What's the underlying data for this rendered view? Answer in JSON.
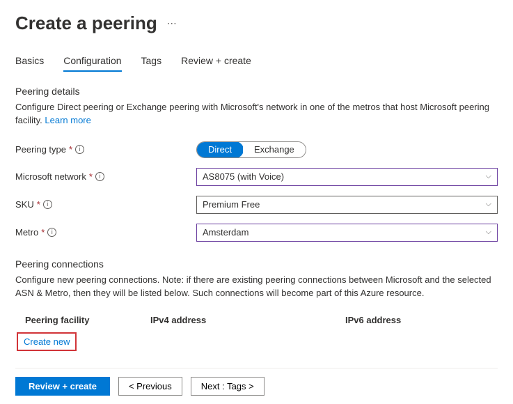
{
  "header": {
    "title": "Create a peering"
  },
  "tabs": {
    "basics": "Basics",
    "configuration": "Configuration",
    "tags": "Tags",
    "review": "Review + create"
  },
  "details": {
    "title": "Peering details",
    "desc": "Configure Direct peering or Exchange peering with Microsoft's network in one of the metros that host Microsoft peering facility. ",
    "learnMore": "Learn more"
  },
  "form": {
    "peeringTypeLabel": "Peering type",
    "peeringTypeOptions": {
      "direct": "Direct",
      "exchange": "Exchange"
    },
    "networkLabel": "Microsoft network",
    "networkValue": "AS8075 (with Voice)",
    "skuLabel": "SKU",
    "skuValue": "Premium Free",
    "metroLabel": "Metro",
    "metroValue": "Amsterdam"
  },
  "connections": {
    "title": "Peering connections",
    "desc": "Configure new peering connections. Note: if there are existing peering connections between Microsoft and the selected ASN & Metro, then they will be listed below. Such connections will become part of this Azure resource.",
    "columns": {
      "facility": "Peering facility",
      "ipv4": "IPv4 address",
      "ipv6": "IPv6 address"
    },
    "createNew": "Create new"
  },
  "footer": {
    "review": "Review + create",
    "previous": "< Previous",
    "next": "Next : Tags >"
  }
}
